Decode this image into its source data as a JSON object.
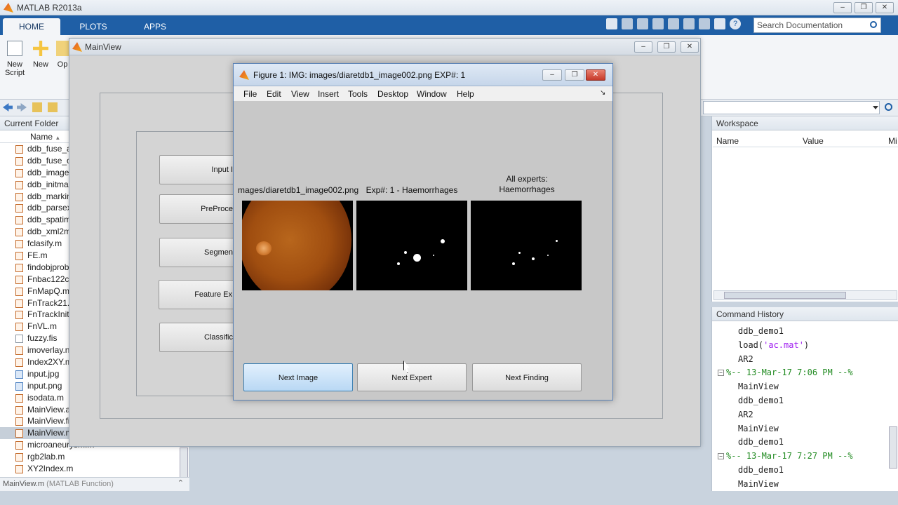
{
  "app": {
    "title": "MATLAB R2013a"
  },
  "ribbon": {
    "tabs": [
      "HOME",
      "PLOTS",
      "APPS"
    ],
    "search_placeholder": "Search Documentation",
    "buttons": {
      "new_script": "New\nScript",
      "new": "New",
      "open": "Op"
    }
  },
  "folder": {
    "title": "Current Folder",
    "col_name": "Name",
    "files": [
      {
        "name": "ddb_fuse_al",
        "type": "m"
      },
      {
        "name": "ddb_fuse_o",
        "type": "m"
      },
      {
        "name": "ddb_images",
        "type": "m"
      },
      {
        "name": "ddb_initma",
        "type": "m"
      },
      {
        "name": "ddb_markin",
        "type": "m"
      },
      {
        "name": "ddb_parsex",
        "type": "m"
      },
      {
        "name": "ddb_spatim",
        "type": "m"
      },
      {
        "name": "ddb_xml2m",
        "type": "m"
      },
      {
        "name": "fclasify.m",
        "type": "m"
      },
      {
        "name": "FE.m",
        "type": "m"
      },
      {
        "name": "findobjprob",
        "type": "m"
      },
      {
        "name": "Fnbac122ca",
        "type": "m"
      },
      {
        "name": "FnMapQ.m",
        "type": "m"
      },
      {
        "name": "FnTrack21.r",
        "type": "m"
      },
      {
        "name": "FnTrackInit",
        "type": "m"
      },
      {
        "name": "FnVL.m",
        "type": "m"
      },
      {
        "name": "fuzzy.fis",
        "type": "file"
      },
      {
        "name": "imoverlay.n",
        "type": "m"
      },
      {
        "name": "Index2XY.m",
        "type": "m"
      },
      {
        "name": "input.jpg",
        "type": "img"
      },
      {
        "name": "input.png",
        "type": "img"
      },
      {
        "name": "isodata.m",
        "type": "m"
      },
      {
        "name": "MainView.a",
        "type": "m"
      },
      {
        "name": "MainView.fi",
        "type": "m"
      },
      {
        "name": "MainView.m",
        "type": "m",
        "selected": true
      },
      {
        "name": "microaneurysm.m",
        "type": "m"
      },
      {
        "name": "rgb2lab.m",
        "type": "m"
      },
      {
        "name": "XY2Index.m",
        "type": "m"
      }
    ],
    "status": "MainView.m",
    "status_suffix": "(MATLAB Function)"
  },
  "workspace": {
    "title": "Workspace",
    "cols": [
      "Name",
      "Value",
      "Mi"
    ]
  },
  "history": {
    "title": "Command History",
    "rows": [
      {
        "kind": "cmd",
        "text": "ddb_demo1"
      },
      {
        "kind": "cmd",
        "text": "load(",
        "str": "'ac.mat'",
        "tail": ")"
      },
      {
        "kind": "cmd",
        "text": "AR2"
      },
      {
        "kind": "grp",
        "text": "%-- 13-Mar-17 7:06 PM --%"
      },
      {
        "kind": "cmd",
        "text": "MainView"
      },
      {
        "kind": "cmd",
        "text": "ddb_demo1"
      },
      {
        "kind": "cmd",
        "text": "AR2"
      },
      {
        "kind": "cmd",
        "text": "MainView"
      },
      {
        "kind": "cmd",
        "text": "ddb_demo1"
      },
      {
        "kind": "grp",
        "text": "%-- 13-Mar-17 7:27 PM --%"
      },
      {
        "kind": "cmd",
        "text": "ddb_demo1"
      },
      {
        "kind": "cmd",
        "text": "MainView"
      }
    ]
  },
  "mainview": {
    "title": "MainView",
    "buttons": [
      "Input I",
      "PreProce",
      "Segmen",
      "Feature Ex",
      "Classific"
    ]
  },
  "figure": {
    "title": "Figure 1: IMG: images/diaretdb1_image002.png EXP#: 1",
    "menu": [
      "File",
      "Edit",
      "View",
      "Insert",
      "Tools",
      "Desktop",
      "Window",
      "Help"
    ],
    "axes_titles": [
      "mages/diaretdb1_image002.png",
      "Exp#: 1 - Haemorrhages",
      "All experts:\nHaemorrhages"
    ],
    "buttons": [
      "Next Image",
      "Next Expert",
      "Next Finding"
    ]
  }
}
